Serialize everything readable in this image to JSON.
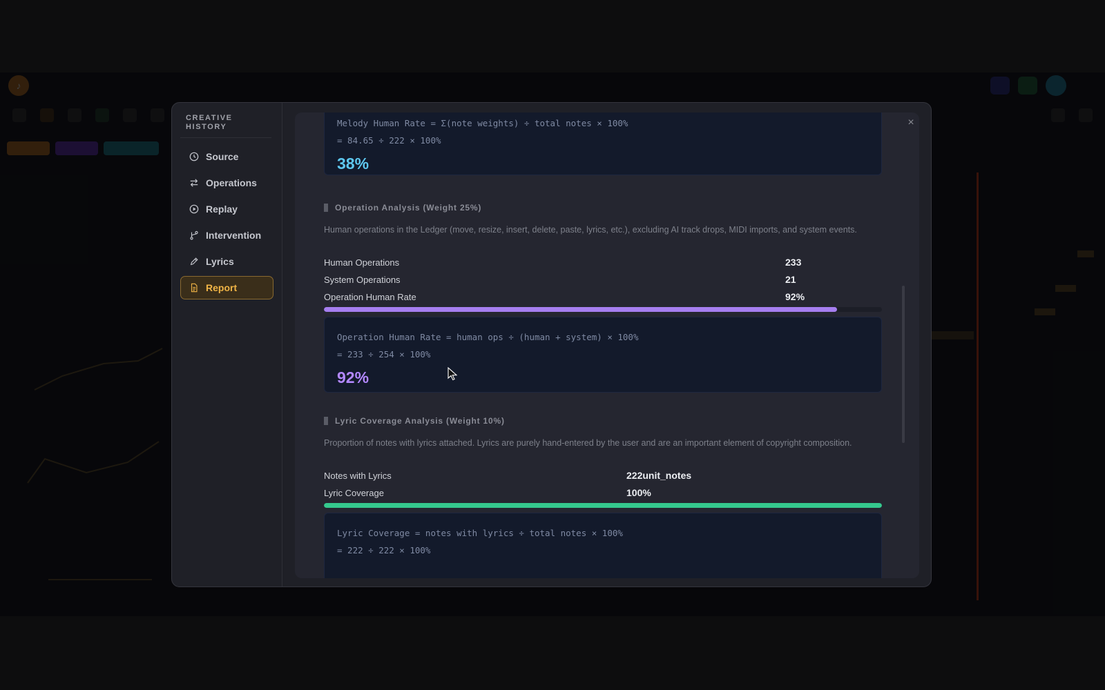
{
  "colors": {
    "accent": "#f0b446",
    "cyan_result": "#5ec8f0",
    "purple_result": "#b388ff",
    "purple_bar": "#a67ef0",
    "green_bar": "#35c98e"
  },
  "modal": {
    "sidebar_title": "CREATIVE HISTORY",
    "nav": [
      {
        "label": "Source",
        "icon": "clock-icon"
      },
      {
        "label": "Operations",
        "icon": "swap-arrows-icon"
      },
      {
        "label": "Replay",
        "icon": "play-circle-icon"
      },
      {
        "label": "Intervention",
        "icon": "branch-icon"
      },
      {
        "label": "Lyrics",
        "icon": "pen-icon"
      },
      {
        "label": "Report",
        "icon": "document-icon",
        "active": true
      }
    ],
    "close_label": "×"
  },
  "melody": {
    "formula_line1": "Melody Human Rate = Σ(note weights) ÷ total notes × 100%",
    "formula_line2": "= 84.65 ÷ 222 × 100%",
    "result": "38%"
  },
  "operation": {
    "title": "Operation Analysis (Weight 25%)",
    "description": "Human operations in the Ledger (move, resize, insert, delete, paste, lyrics, etc.), excluding AI track drops, MIDI imports, and system events.",
    "rows": [
      {
        "label": "Human Operations",
        "value": "233"
      },
      {
        "label": "System Operations",
        "value": "21"
      },
      {
        "label": "Operation Human Rate",
        "value": "92%"
      }
    ],
    "progress_fraction": 0.92,
    "formula_line1": "Operation Human Rate = human ops ÷ (human + system) × 100%",
    "formula_line2": "= 233 ÷ 254 × 100%",
    "result": "92%"
  },
  "lyric": {
    "title": "Lyric Coverage Analysis (Weight 10%)",
    "description": "Proportion of notes with lyrics attached. Lyrics are purely hand-entered by the user and are an important element of copyright composition.",
    "rows": [
      {
        "label": "Notes with Lyrics",
        "value": "222unit_notes"
      },
      {
        "label": "Lyric Coverage",
        "value": "100%"
      }
    ],
    "progress_fraction": 1.0,
    "formula_line1": "Lyric Coverage = notes with lyrics ÷ total notes × 100%",
    "formula_line2": "= 222 ÷ 222 × 100%"
  }
}
